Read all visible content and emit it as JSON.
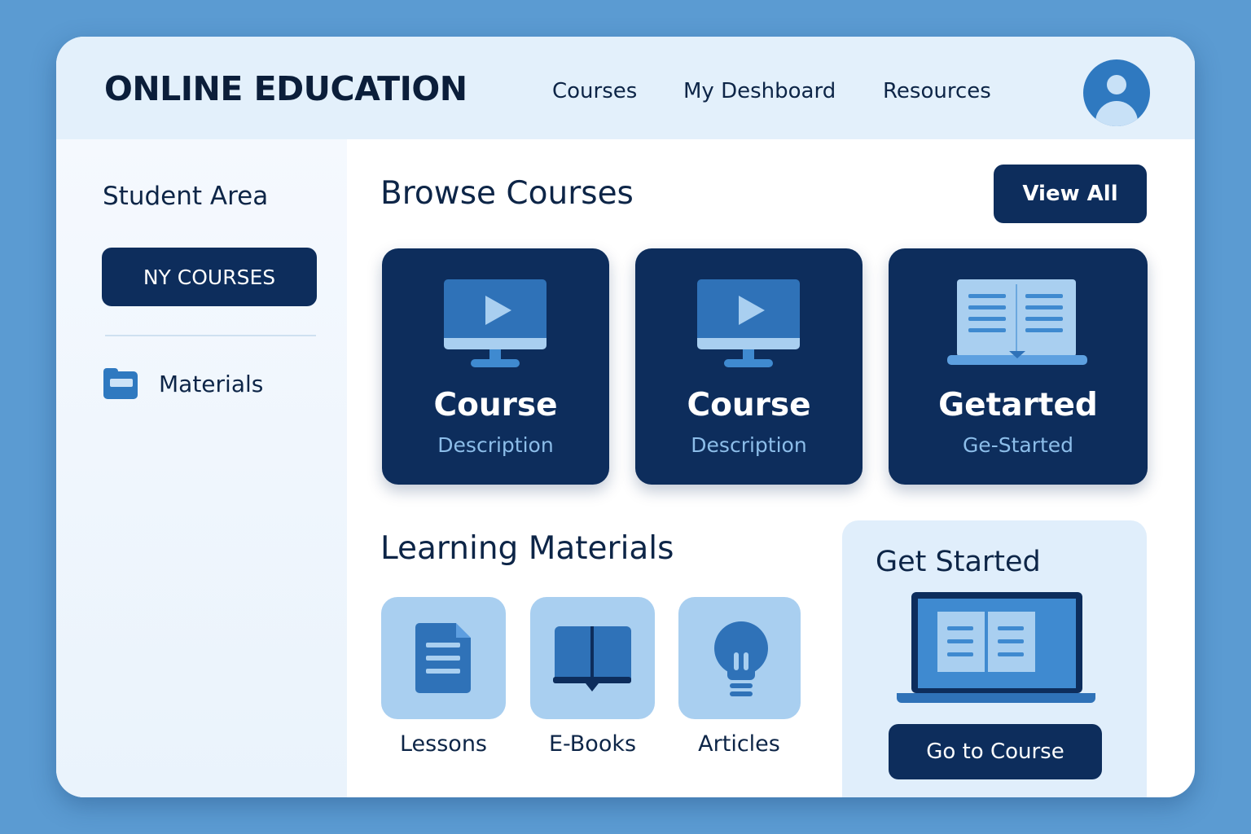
{
  "header": {
    "brand": "ONLINE EDUCATION",
    "nav": [
      "Courses",
      "My Deshboard",
      "Resources"
    ],
    "avatar_icon": "user-avatar-icon"
  },
  "sidebar": {
    "title": "Student Area",
    "button_label": "NY COURSES",
    "items": [
      {
        "label": "Materials",
        "icon": "folder-icon"
      }
    ]
  },
  "browse": {
    "title": "Browse Courses",
    "view_all_label": "View All",
    "cards": [
      {
        "title": "Course",
        "subtitle": "Description",
        "icon": "video-monitor-icon"
      },
      {
        "title": "Course",
        "subtitle": "Description",
        "icon": "video-monitor-icon"
      },
      {
        "title": "Getarted",
        "subtitle": "Ge-Started",
        "icon": "laptop-book-icon"
      }
    ]
  },
  "materials": {
    "title": "Learning Materials",
    "tiles": [
      {
        "label": "Lessons",
        "icon": "document-icon"
      },
      {
        "label": "E-Books",
        "icon": "open-book-icon"
      },
      {
        "label": "Articles",
        "icon": "lightbulb-icon"
      }
    ]
  },
  "get_started": {
    "title": "Get Started",
    "button_label": "Go to Course",
    "icon": "laptop-icon"
  },
  "colors": {
    "background": "#5b9bd2",
    "navy": "#0d2d5c",
    "accent_blue": "#2f72b8",
    "light_blue": "#a9cff0",
    "header_bg": "#e3f0fb"
  }
}
